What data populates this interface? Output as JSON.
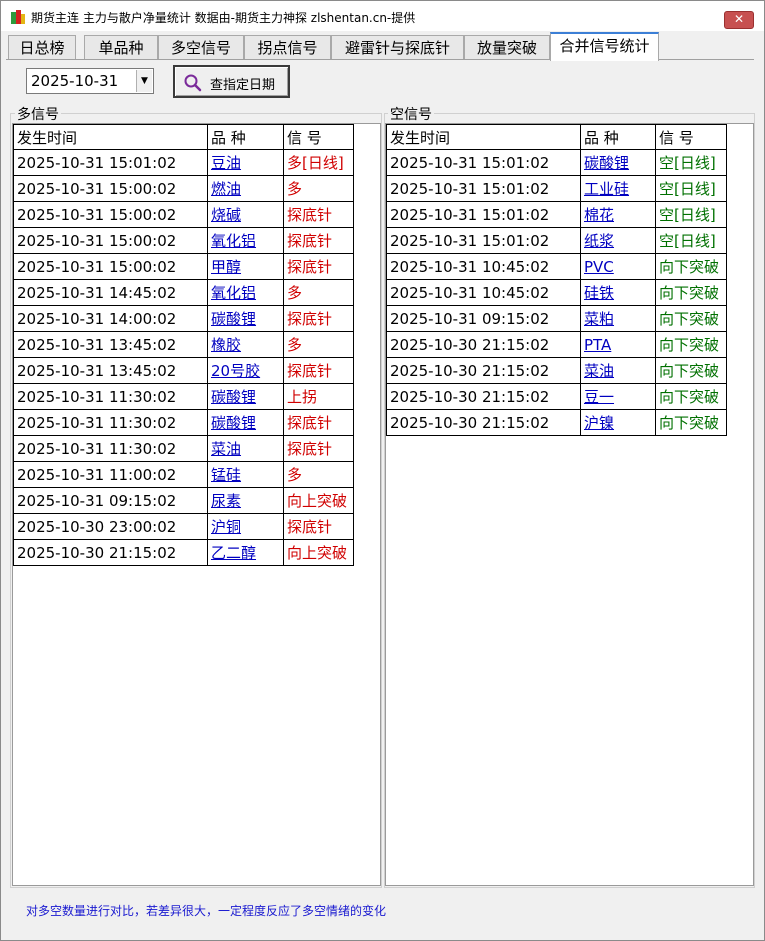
{
  "window": {
    "title": "期货主连 主力与散户净量统计 数据由-期货主力神探 zlshentan.cn-提供",
    "close_label": "✕"
  },
  "tabs": [
    "日总榜",
    "单品种",
    "多空信号",
    "拐点信号",
    "避雷针与探底针",
    "放量突破",
    "合并信号统计"
  ],
  "active_tab": 6,
  "toolbar": {
    "date_value": "2025-10-31",
    "query_label": "查指定日期"
  },
  "long_panel": {
    "title": "多信号",
    "headers": [
      "发生时间",
      "品 种",
      "信 号"
    ],
    "rows": [
      [
        "2025-10-31 15:01:02",
        "豆油",
        "多[日线]"
      ],
      [
        "2025-10-31 15:00:02",
        "燃油",
        "多"
      ],
      [
        "2025-10-31 15:00:02",
        "烧碱",
        "探底针"
      ],
      [
        "2025-10-31 15:00:02",
        "氧化铝",
        "探底针"
      ],
      [
        "2025-10-31 15:00:02",
        "甲醇",
        "探底针"
      ],
      [
        "2025-10-31 14:45:02",
        "氧化铝",
        "多"
      ],
      [
        "2025-10-31 14:00:02",
        "碳酸锂",
        "探底针"
      ],
      [
        "2025-10-31 13:45:02",
        "橡胶",
        "多"
      ],
      [
        "2025-10-31 13:45:02",
        "20号胶",
        "探底针"
      ],
      [
        "2025-10-31 11:30:02",
        "碳酸锂",
        "上拐"
      ],
      [
        "2025-10-31 11:30:02",
        "碳酸锂",
        "探底针"
      ],
      [
        "2025-10-31 11:30:02",
        "菜油",
        "探底针"
      ],
      [
        "2025-10-31 11:00:02",
        "锰硅",
        "多"
      ],
      [
        "2025-10-31 09:15:02",
        "尿素",
        "向上突破"
      ],
      [
        "2025-10-30 23:00:02",
        "沪铜",
        "探底针"
      ],
      [
        "2025-10-30 21:15:02",
        "乙二醇",
        "向上突破"
      ]
    ]
  },
  "short_panel": {
    "title": "空信号",
    "headers": [
      "发生时间",
      "品 种",
      "信 号"
    ],
    "rows": [
      [
        "2025-10-31 15:01:02",
        "碳酸锂",
        "空[日线]"
      ],
      [
        "2025-10-31 15:01:02",
        "工业硅",
        "空[日线]"
      ],
      [
        "2025-10-31 15:01:02",
        "棉花",
        "空[日线]"
      ],
      [
        "2025-10-31 15:01:02",
        "纸浆",
        "空[日线]"
      ],
      [
        "2025-10-31 10:45:02",
        "PVC",
        "向下突破"
      ],
      [
        "2025-10-31 10:45:02",
        "硅铁",
        "向下突破"
      ],
      [
        "2025-10-31 09:15:02",
        "菜粕",
        "向下突破"
      ],
      [
        "2025-10-30 21:15:02",
        "PTA",
        "向下突破"
      ],
      [
        "2025-10-30 21:15:02",
        "菜油",
        "向下突破"
      ],
      [
        "2025-10-30 21:15:02",
        "豆一",
        "向下突破"
      ],
      [
        "2025-10-30 21:15:02",
        "沪镍",
        "向下突破"
      ]
    ]
  },
  "footer": {
    "hint": "对多空数量进行对比，若差异很大，一定程度反应了多空情绪的变化"
  },
  "colors": {
    "long_signal": "#d00000",
    "short_signal": "#007000",
    "link": "#0000c0",
    "tab_accent": "#3c7fd6"
  },
  "icons": {
    "app": "app-bar-chart-icon",
    "query": "magnifier-icon",
    "dropdown": "chevron-down-icon"
  }
}
